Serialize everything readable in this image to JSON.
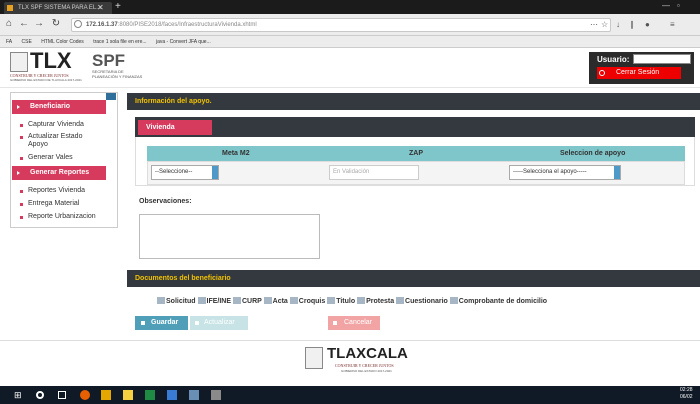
{
  "browser": {
    "tab_title": "TLX SPF SISTEMA PARA EL...",
    "url_host": "172.16.1.37",
    "url_path": ":8080/PISE2018/faces/InfraestructuraVivienda.xhtml",
    "bookmarks": [
      "FA",
      "CSE",
      "HTML Color Codes",
      "trace 1 sola file en ere...",
      "java - Convert JFA que..."
    ]
  },
  "header": {
    "tlx_logo": "TLX",
    "tlx_tagline": "CONSTRUIR Y CRECER JUNTOS",
    "tlx_sub": "GOBIERNO DEL ESTADO DE TLAXCALA 2017-2021",
    "spf_logo": "SPF",
    "spf_line1": "SECRETARIA DE",
    "spf_line2": "PLANEACIÓN Y FINANZAS",
    "user_label": "Usuario:",
    "user_value": "",
    "logout_label": "Cerrar Sesión"
  },
  "sidebar": {
    "section1": "Beneficiario",
    "items1": [
      "Capturar Vivienda",
      "Actualizar Estado",
      "Apoyo",
      "Generar Vales"
    ],
    "section2": "Generar Reportes",
    "items2": [
      "Reportes Vivienda",
      "Entrega Material",
      "Reporte Urbanizacion"
    ]
  },
  "main": {
    "info_title": "Información del apoyo.",
    "tab_label": "Vivienda",
    "columns": [
      "Meta M2",
      "ZAP",
      "Seleccion de apoyo"
    ],
    "meta_select": "--Seleccione--",
    "zap_placeholder": "En Validación",
    "apoyo_select": "-----Selecciona el apoyo-----",
    "obs_label": "Observaciones:",
    "docs_title": "Documentos del beneficiario",
    "documents": [
      "Solicitud",
      "IFE/INE",
      "CURP",
      "Acta",
      "Croquis",
      "Titulo",
      "Protesta",
      "Cuestionario",
      "Comprobante de domicilio"
    ],
    "save_label": "Guardar",
    "update_label": "Actualizar",
    "cancel_label": "Cancelar"
  },
  "footer": {
    "logo_text": "TLAXCALA",
    "logo_tagline": "CONSTRUIR Y CRECER JUNTOS",
    "logo_sub": "GOBIERNO DEL ESTADO 2017-2021"
  },
  "taskbar": {
    "time": "02:28",
    "date": "06/02"
  },
  "colors": {
    "accent": "#d63a5c",
    "dark_bar": "#34393f",
    "bar_text": "#f2c200",
    "grid_header": "#7fc6ca",
    "logout": "#ee0000"
  }
}
